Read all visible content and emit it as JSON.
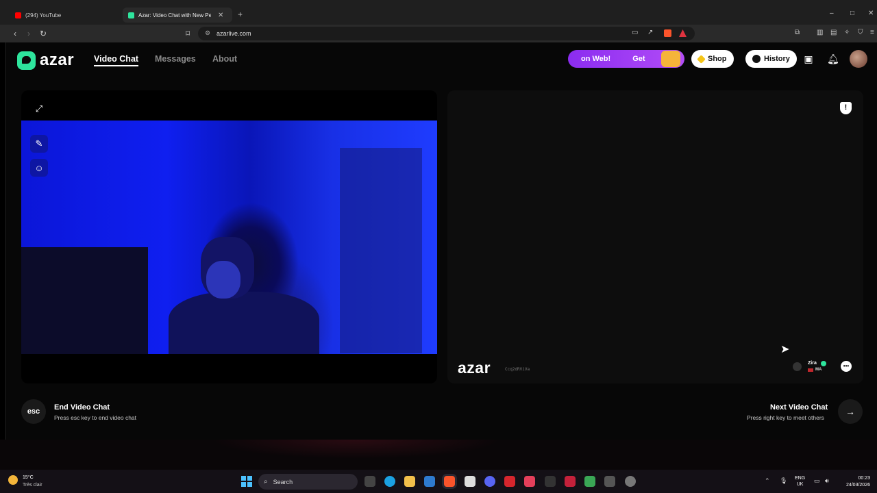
{
  "browser": {
    "tabs": [
      {
        "label": "(294) YouTube",
        "active": false,
        "favicon_color": "#ff0000"
      },
      {
        "label": "Azar: Video Chat with New Pe",
        "active": true,
        "favicon_color": "#2ee59d"
      }
    ],
    "new_tab": "+",
    "window_controls": {
      "minimize": "–",
      "maximize": "□",
      "close": "✕"
    },
    "url": "azarlive.com"
  },
  "header": {
    "logo_text": "azar",
    "nav": [
      {
        "label": "Video Chat",
        "active": true
      },
      {
        "label": "Messages",
        "active": false
      },
      {
        "label": "About",
        "active": false
      }
    ],
    "promo": {
      "part1": "on Web!",
      "part2": "Get"
    },
    "shop_label": "Shop",
    "history_label": "History"
  },
  "left_panel": {
    "tools": [
      "expand-icon",
      "magic-wand-icon",
      "sticker-icon"
    ]
  },
  "right_panel": {
    "watermark": "azar",
    "watermark_code": "Ccq2dRViVa",
    "peer": {
      "name": "Zira",
      "country": "MA"
    }
  },
  "controls": {
    "end": {
      "key": "esc",
      "title": "End Video Chat",
      "subtitle": "Press esc key to end video chat"
    },
    "next": {
      "key": "→",
      "title": "Next Video Chat",
      "subtitle": "Press right key to meet others"
    }
  },
  "taskbar": {
    "weather": {
      "temp": "15°C",
      "desc": "Très clair"
    },
    "search_placeholder": "Search",
    "lang": {
      "line1": "ENG",
      "line2": "UK"
    },
    "clock": {
      "time": "00:23",
      "date": "24/03/2026"
    }
  },
  "colors": {
    "accent": "#2ee59d",
    "promo": "#9b3cf3",
    "video_tint": "#0f1ff0"
  }
}
